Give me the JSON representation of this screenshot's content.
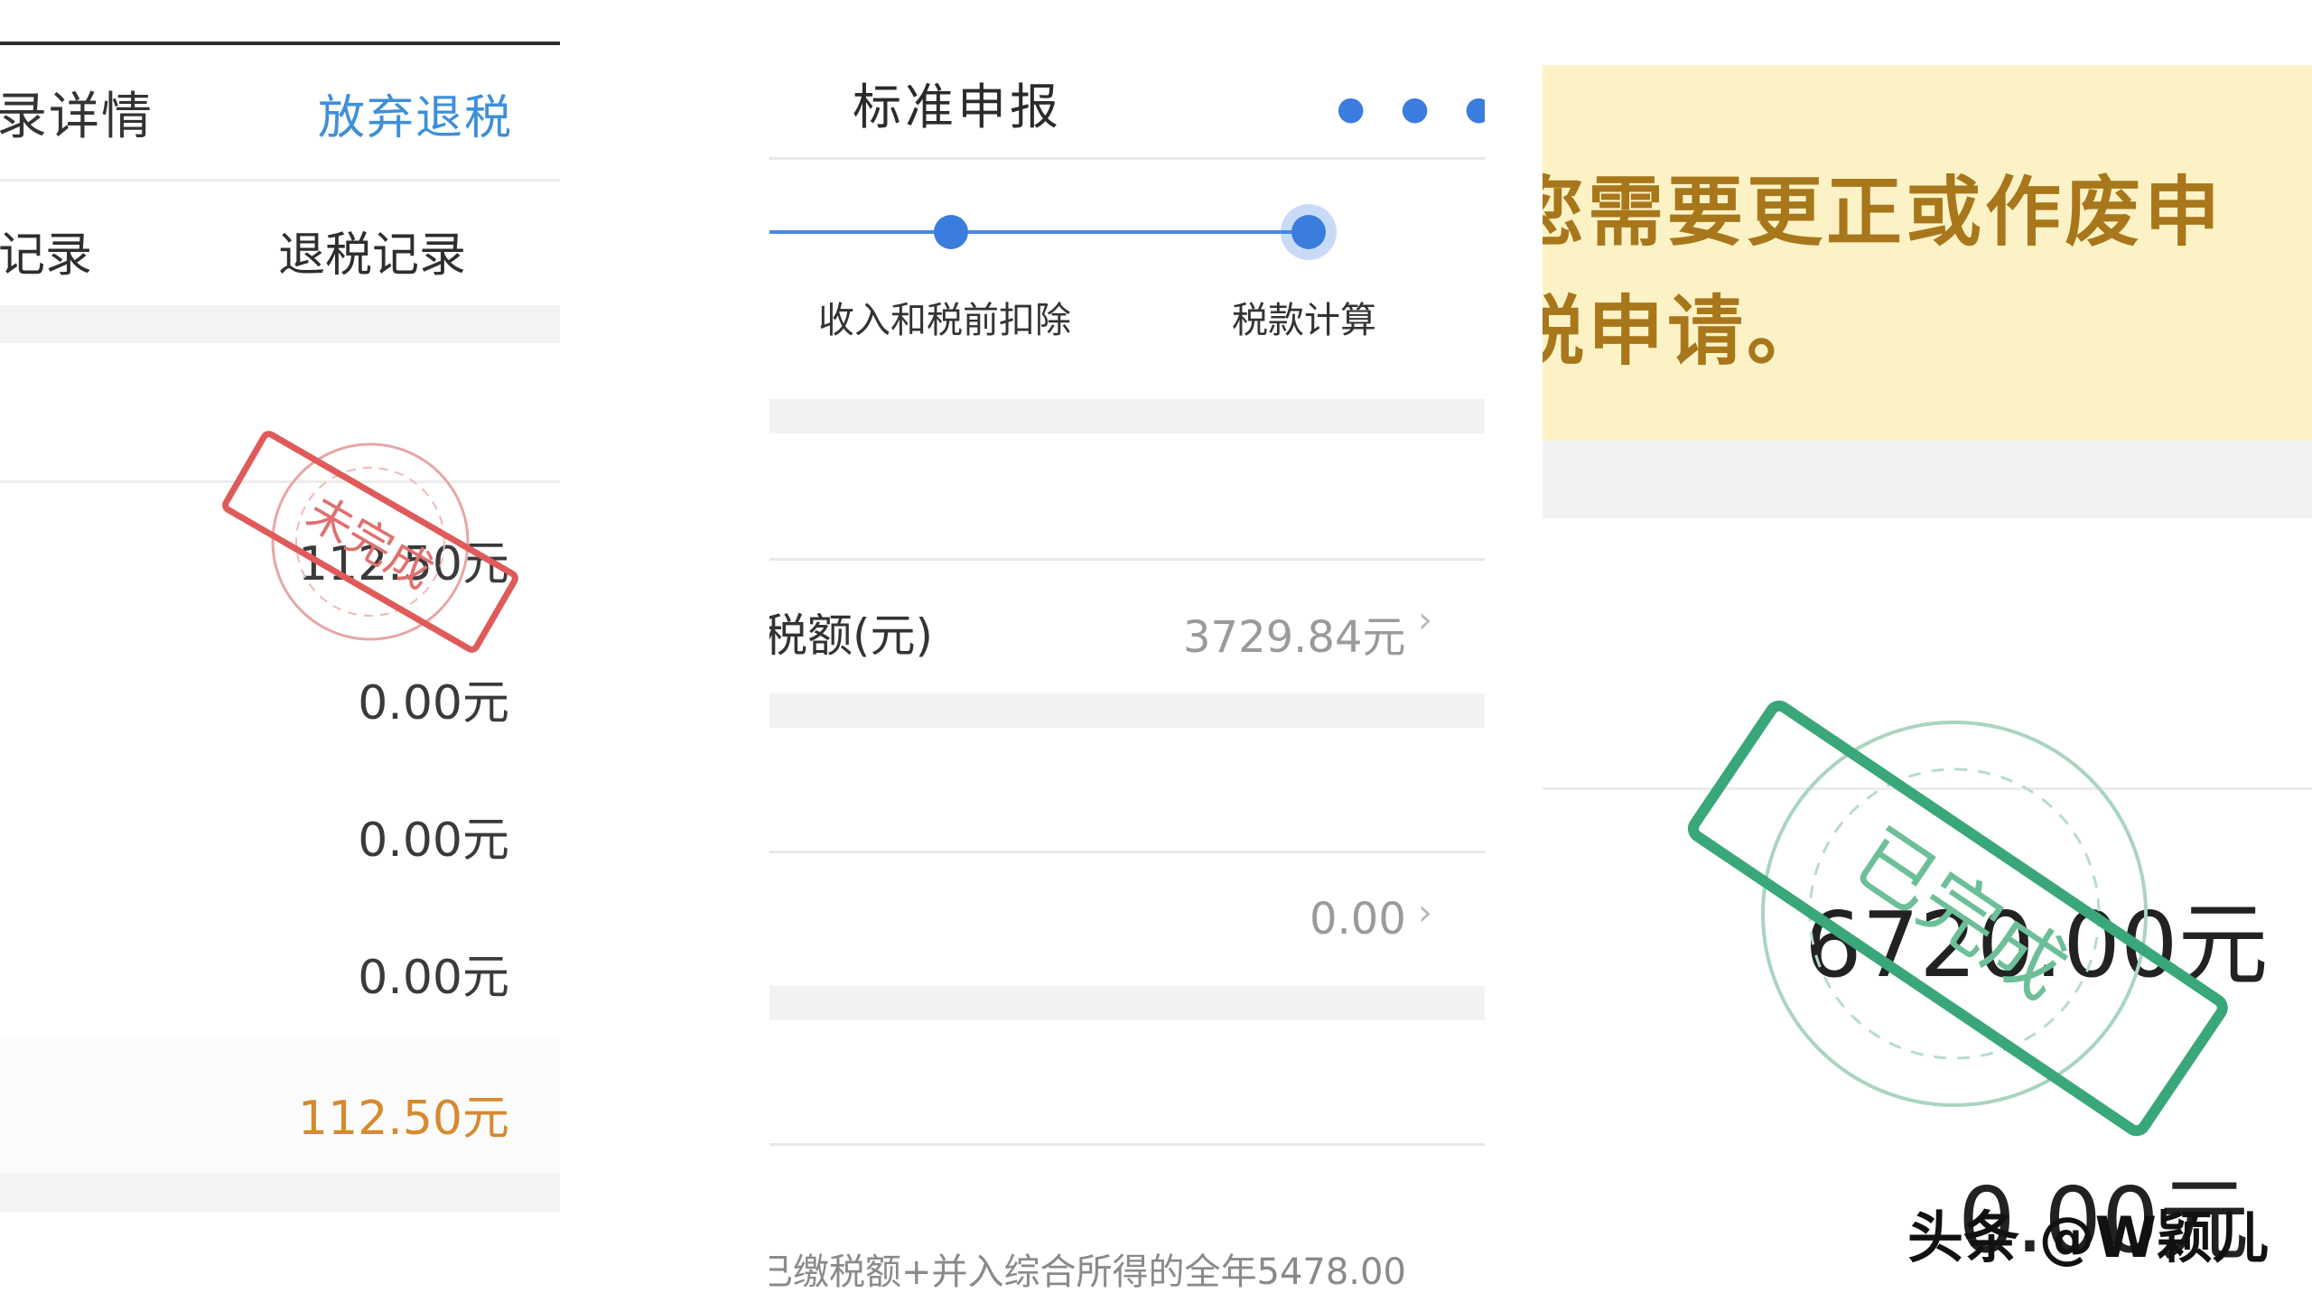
{
  "left_panel": {
    "title": "录详情",
    "action_link": "放弃退税",
    "tabs": [
      "记录",
      "退税记录"
    ],
    "amounts": [
      "112.50元",
      "0.00元",
      "0.00元",
      "0.00元"
    ],
    "total": "112.50元",
    "stamp_text": "未完成",
    "stamp_color": "#e05a5a"
  },
  "middle_panel": {
    "title": "标准申报",
    "more_icon": "more-dots-icon",
    "steps": [
      "收入和税前扣除",
      "税款计算"
    ],
    "accent": "#3b7ddd",
    "rows": [
      {
        "label": "税额(元)",
        "value": "3729.84元"
      },
      {
        "label": "",
        "value": "0.00"
      }
    ],
    "footnote": "已缴税额+并入综合所得的全年5478.00"
  },
  "right_panel": {
    "notice_lines": [
      "您需要更正或作废申",
      "税申请。"
    ],
    "notice_bg": "#fcf2c5",
    "amount": "6720.00元",
    "amount_secondary": "0.00元",
    "stamp_text": "已完成",
    "stamp_color": "#3aa77a"
  },
  "watermark": "头条 @W颖儿"
}
